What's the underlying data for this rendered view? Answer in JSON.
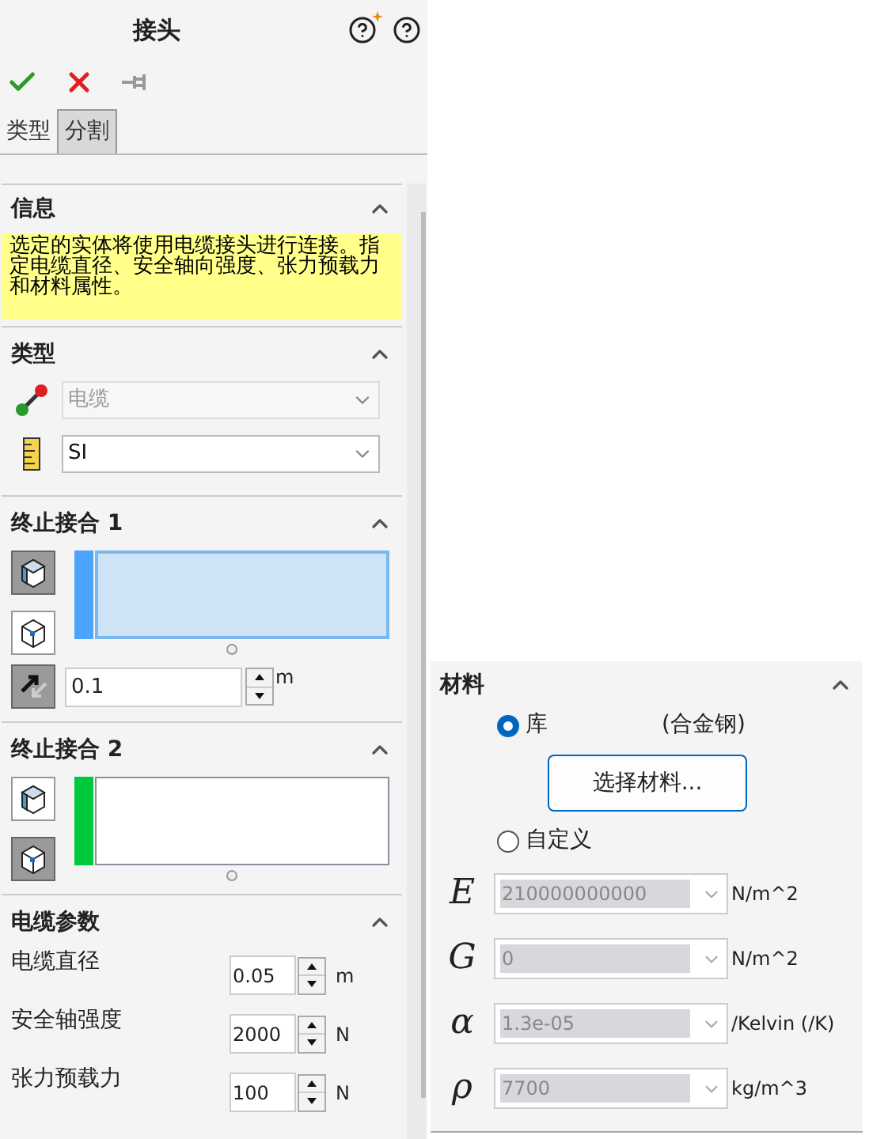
{
  "title": "接头",
  "tabs": [
    {
      "label": "类型",
      "selected": true
    },
    {
      "label": "分割",
      "selected": false
    }
  ],
  "info": {
    "title": "信息",
    "expanded": true,
    "text": "选定的实体将使用电缆接头进行连接。指定电缆直径、安全轴向强度、张力预载力和材料属性。"
  },
  "type_section": {
    "title": "类型",
    "expanded": true,
    "fields": [
      {
        "kind": "cable",
        "value": "电缆",
        "disabled": true
      },
      {
        "kind": "units",
        "value": "SI",
        "disabled": false
      }
    ]
  },
  "end_connections": [
    {
      "title": "终止接合 1",
      "expanded": true,
      "color": "#4da3ff",
      "active": true,
      "mode_buttons": [
        {
          "kind": "face",
          "selected": true
        },
        {
          "kind": "vertex",
          "selected": false
        }
      ],
      "offset": {
        "value": "0.1",
        "unit": "m"
      }
    },
    {
      "title": "终止接合 2",
      "expanded": true,
      "color": "#00c83c",
      "active": false,
      "mode_buttons": [
        {
          "kind": "face",
          "selected": false
        },
        {
          "kind": "vertex",
          "selected": true
        }
      ]
    }
  ],
  "cable_params": {
    "title": "电缆参数",
    "expanded": true,
    "rows": [
      {
        "label": "电缆直径",
        "value": "0.05",
        "unit": "m"
      },
      {
        "label": "安全轴强度",
        "value": "2000",
        "unit": "N"
      },
      {
        "label": "张力预载力",
        "value": "100",
        "unit": "N"
      }
    ]
  },
  "material": {
    "title": "材料",
    "expanded": true,
    "options": [
      {
        "label": "库",
        "selected": true
      },
      {
        "label": "自定义",
        "selected": false
      }
    ],
    "library_name": "(合金钢)",
    "button": "选择材料...",
    "properties": [
      {
        "symbol": "E",
        "value": "210000000000",
        "unit": "N/m^2",
        "disabled": true
      },
      {
        "symbol": "G",
        "value": "0",
        "unit": "N/m^2",
        "disabled": true
      },
      {
        "symbol": "α",
        "value": "1.3e-05",
        "unit": "/Kelvin (/K)",
        "disabled": true
      },
      {
        "symbol": "ρ",
        "value": "7700",
        "unit": "kg/m^3",
        "disabled": true
      }
    ]
  }
}
